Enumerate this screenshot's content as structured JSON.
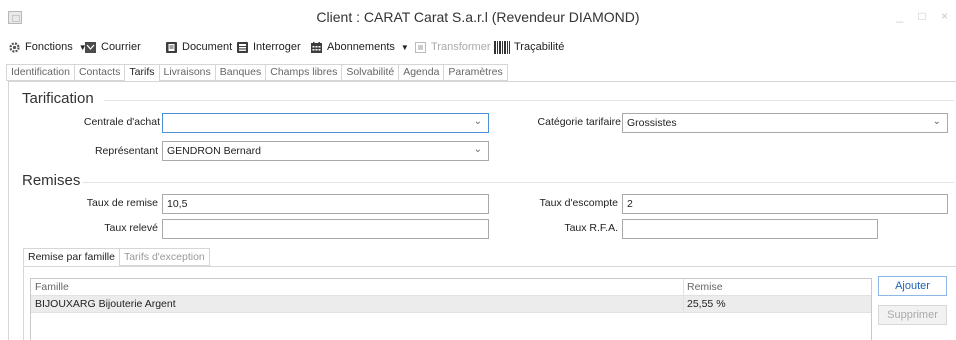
{
  "window": {
    "title": "Client : CARAT Carat S.a.r.l (Revendeur DIAMOND)",
    "controls": "_ □ ×"
  },
  "toolbar": {
    "items": [
      {
        "label": "Fonctions",
        "icon": "gear-icon",
        "has_dropdown": true,
        "enabled": true
      },
      {
        "label": "Courrier",
        "icon": "mail-icon",
        "enabled": true
      },
      {
        "label": "Document",
        "icon": "document-icon",
        "enabled": true
      },
      {
        "label": "Interroger",
        "icon": "query-icon",
        "enabled": true
      },
      {
        "label": "Abonnements",
        "icon": "calendar-icon",
        "has_dropdown": true,
        "enabled": true
      },
      {
        "label": "Transformer",
        "icon": "transform-icon",
        "enabled": false
      },
      {
        "label": "Traçabilité",
        "icon": "barcode-icon",
        "enabled": true
      }
    ]
  },
  "tabs": [
    {
      "label": "Identification",
      "active": false
    },
    {
      "label": "Contacts",
      "active": false
    },
    {
      "label": "Tarifs",
      "active": true
    },
    {
      "label": "Livraisons",
      "active": false
    },
    {
      "label": "Banques",
      "active": false
    },
    {
      "label": "Champs libres",
      "active": false
    },
    {
      "label": "Solvabilité",
      "active": false
    },
    {
      "label": "Agenda",
      "active": false
    },
    {
      "label": "Paramètres",
      "active": false
    }
  ],
  "tarification": {
    "title": "Tarification",
    "centrale_label": "Centrale d'achat",
    "centrale_value": "",
    "categorie_label": "Catégorie tarifaire",
    "categorie_value": "Grossistes",
    "representant_label": "Représentant",
    "representant_value": "GENDRON Bernard"
  },
  "remises": {
    "title": "Remises",
    "taux_remise_label": "Taux de remise",
    "taux_remise_value": "10,5",
    "taux_escompte_label": "Taux d'escompte",
    "taux_escompte_value": "2",
    "taux_releve_label": "Taux relevé",
    "taux_releve_value": "",
    "taux_rfa_label": "Taux R.F.A.",
    "taux_rfa_value": ""
  },
  "subtabs": [
    {
      "label": "Remise par famille",
      "active": true
    },
    {
      "label": "Tarifs d'exception",
      "active": false
    }
  ],
  "grid": {
    "columns": [
      "Famille",
      "Remise"
    ],
    "rows": [
      {
        "famille": "BIJOUXARG Bijouterie Argent",
        "remise": "25,55 %"
      }
    ]
  },
  "buttons": {
    "ajouter": "Ajouter",
    "supprimer": "Supprimer"
  },
  "colors": {
    "accent": "#1f63b3",
    "focus_border": "#4d8fd6",
    "selected_row": "#ececec"
  }
}
